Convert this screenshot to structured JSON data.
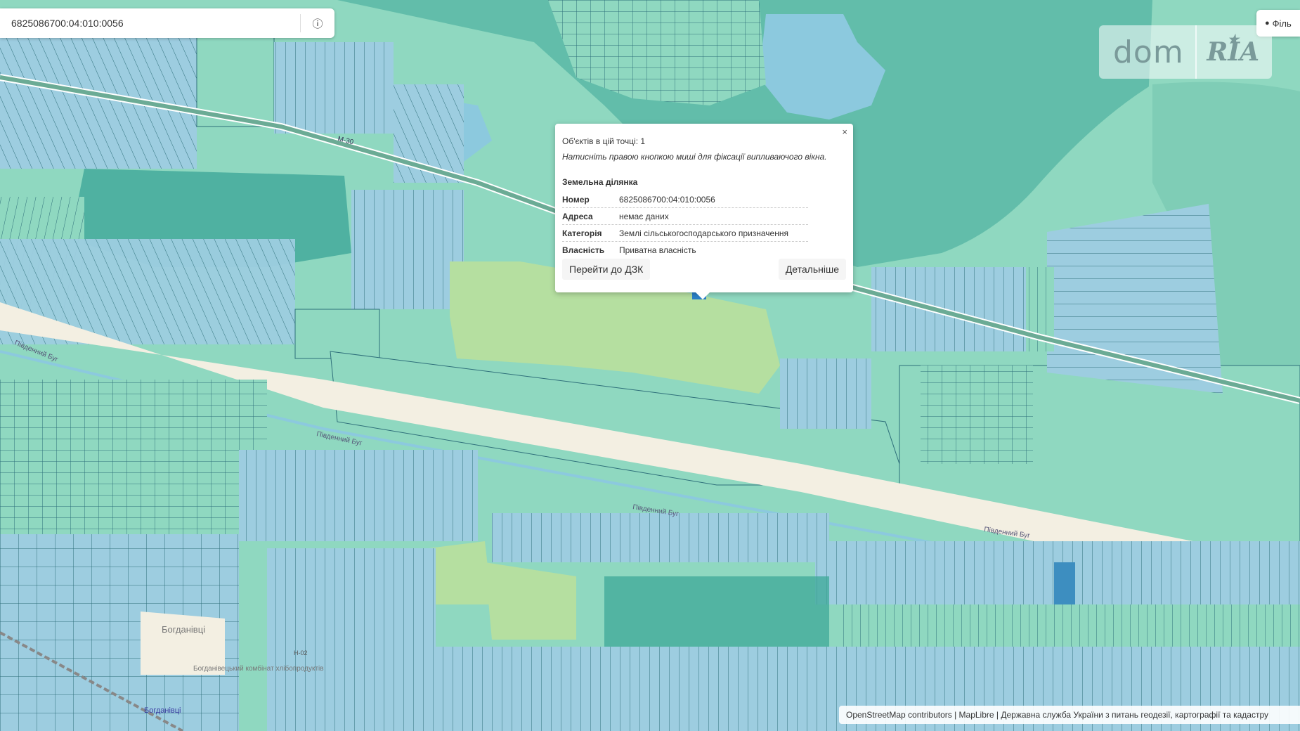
{
  "search": {
    "query": "6825086700:04:010:0056",
    "info_icon": "info-icon"
  },
  "filters_label": "Філь",
  "brand": {
    "dom": "dom",
    "ria": "RIA"
  },
  "popup": {
    "close": "×",
    "count": "Об'єктів в цій точці: 1",
    "hint": "Натисніть правою кнопкою миші для фіксації випливаючого вікна.",
    "section_title": "Земельна ділянка",
    "rows": [
      {
        "key": "Номер",
        "value": "6825086700:04:010:0056"
      },
      {
        "key": "Адреса",
        "value": "немає даних"
      },
      {
        "key": "Категорія",
        "value": "Землі сільськогосподарського призначення"
      },
      {
        "key": "Власність",
        "value": "Приватна власність"
      }
    ],
    "btn_dzk": "Перейти до ДЗК",
    "btn_more": "Детальніше"
  },
  "map_labels": {
    "road_m30": "М-30",
    "river_1": "Південний Буг",
    "river_2": "Південний Буг",
    "river_3": "Південний Буг",
    "river_4": "Південний Буг",
    "village": "Богданівці",
    "factory": "Богданівецький комбінат хлібопродуктів",
    "station": "Богданівці",
    "road_code": "Н-02"
  },
  "attribution": "OpenStreetMap contributors | MapLibre | Державна служба України з питань геодезії, картографії та кадастру",
  "colors": {
    "parcel_teal": "#8fd8c0",
    "parcel_blue": "#9dcde0",
    "forest": "#b5dfa0",
    "water": "#8cc9de",
    "road": "#f3efe2",
    "parcel_border": "#2e6f7a"
  }
}
